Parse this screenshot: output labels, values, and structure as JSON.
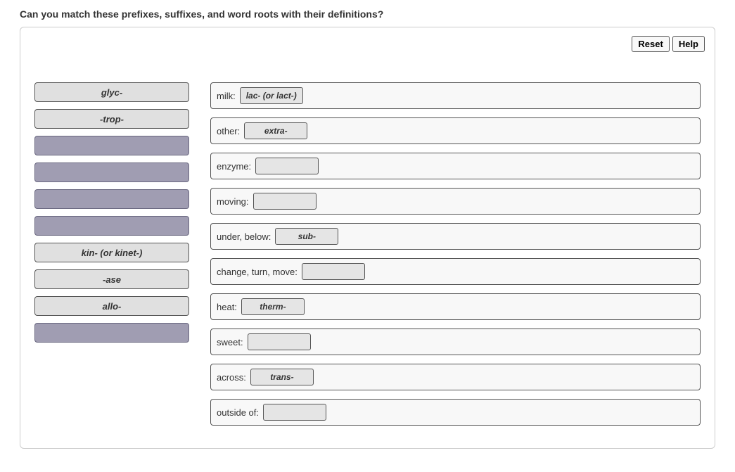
{
  "title": "Can you match these prefixes, suffixes, and word roots with their definitions?",
  "toolbar": {
    "reset_label": "Reset",
    "help_label": "Help"
  },
  "source_items": [
    {
      "label": "glyc-",
      "empty": false
    },
    {
      "label": "-trop-",
      "empty": false
    },
    {
      "label": "",
      "empty": true
    },
    {
      "label": "",
      "empty": true
    },
    {
      "label": "",
      "empty": true
    },
    {
      "label": "",
      "empty": true
    },
    {
      "label": "kin- (or kinet-)",
      "empty": false
    },
    {
      "label": "-ase",
      "empty": false
    },
    {
      "label": "allo-",
      "empty": false
    },
    {
      "label": "",
      "empty": true
    }
  ],
  "target_rows": [
    {
      "label": "milk:",
      "value": "lac- (or lact-)"
    },
    {
      "label": "other:",
      "value": "extra-"
    },
    {
      "label": "enzyme:",
      "value": ""
    },
    {
      "label": "moving:",
      "value": ""
    },
    {
      "label": "under, below:",
      "value": "sub-"
    },
    {
      "label": "change, turn, move:",
      "value": ""
    },
    {
      "label": "heat:",
      "value": "therm-"
    },
    {
      "label": "sweet:",
      "value": ""
    },
    {
      "label": "across:",
      "value": "trans-"
    },
    {
      "label": "outside of:",
      "value": ""
    }
  ]
}
